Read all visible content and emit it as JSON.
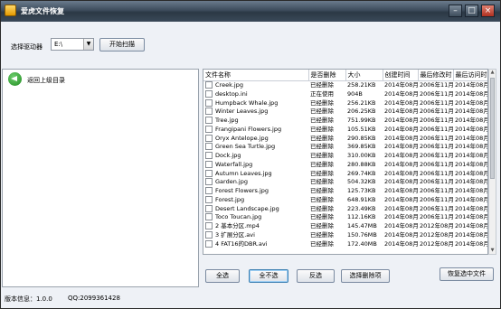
{
  "title": "爱虎文件恢复",
  "window_controls": {
    "minimize": "–",
    "maximize": "□",
    "close": "×"
  },
  "drive": {
    "label": "选择驱动器",
    "value": "E:\\",
    "scan_label": "开始扫描"
  },
  "left_pane": {
    "back_label": "返回上级目录"
  },
  "columns": [
    "文件名称",
    "是否删除",
    "大小",
    "创建时间",
    "最后修改时",
    "最后访问时"
  ],
  "rows": [
    {
      "name": "Creek.jpg",
      "status": "已经删除",
      "size": "258.21KB",
      "created": "2014年08月",
      "modified": "2006年11月",
      "accessed": "2014年08月"
    },
    {
      "name": "desktop.ini",
      "status": "正在使用",
      "size": "904B",
      "created": "2014年08月",
      "modified": "2006年11月",
      "accessed": "2014年08月"
    },
    {
      "name": "Humpback Whale.jpg",
      "status": "已经删除",
      "size": "256.21KB",
      "created": "2014年08月",
      "modified": "2006年11月",
      "accessed": "2014年08月"
    },
    {
      "name": "Winter Leaves.jpg",
      "status": "已经删除",
      "size": "206.25KB",
      "created": "2014年08月",
      "modified": "2006年11月",
      "accessed": "2014年08月"
    },
    {
      "name": "Tree.jpg",
      "status": "已经删除",
      "size": "751.99KB",
      "created": "2014年08月",
      "modified": "2006年11月",
      "accessed": "2014年08月"
    },
    {
      "name": "Frangipani Flowers.jpg",
      "status": "已经删除",
      "size": "105.51KB",
      "created": "2014年08月",
      "modified": "2006年11月",
      "accessed": "2014年08月"
    },
    {
      "name": "Oryx Antelope.jpg",
      "status": "已经删除",
      "size": "290.85KB",
      "created": "2014年08月",
      "modified": "2006年11月",
      "accessed": "2014年08月"
    },
    {
      "name": "Green Sea Turtle.jpg",
      "status": "已经删除",
      "size": "369.85KB",
      "created": "2014年08月",
      "modified": "2006年11月",
      "accessed": "2014年08月"
    },
    {
      "name": "Dock.jpg",
      "status": "已经删除",
      "size": "310.00KB",
      "created": "2014年08月",
      "modified": "2006年11月",
      "accessed": "2014年08月"
    },
    {
      "name": "Waterfall.jpg",
      "status": "已经删除",
      "size": "280.88KB",
      "created": "2014年08月",
      "modified": "2006年11月",
      "accessed": "2014年08月"
    },
    {
      "name": "Autumn Leaves.jpg",
      "status": "已经删除",
      "size": "269.74KB",
      "created": "2014年08月",
      "modified": "2006年11月",
      "accessed": "2014年08月"
    },
    {
      "name": "Garden.jpg",
      "status": "已经删除",
      "size": "504.32KB",
      "created": "2014年08月",
      "modified": "2006年11月",
      "accessed": "2014年08月"
    },
    {
      "name": "Forest Flowers.jpg",
      "status": "已经删除",
      "size": "125.73KB",
      "created": "2014年08月",
      "modified": "2006年11月",
      "accessed": "2014年08月"
    },
    {
      "name": "Forest.jpg",
      "status": "已经删除",
      "size": "648.91KB",
      "created": "2014年08月",
      "modified": "2006年11月",
      "accessed": "2014年08月"
    },
    {
      "name": "Desert Landscape.jpg",
      "status": "已经删除",
      "size": "223.49KB",
      "created": "2014年08月",
      "modified": "2006年11月",
      "accessed": "2014年08月"
    },
    {
      "name": "Toco Toucan.jpg",
      "status": "已经删除",
      "size": "112.16KB",
      "created": "2014年08月",
      "modified": "2006年11月",
      "accessed": "2014年08月"
    },
    {
      "name": "2 基本分区.mp4",
      "status": "已经删除",
      "size": "145.47MB",
      "created": "2014年08月",
      "modified": "2012年08月",
      "accessed": "2014年08月"
    },
    {
      "name": "3 扩展分区.avi",
      "status": "已经删除",
      "size": "150.76MB",
      "created": "2014年08月",
      "modified": "2012年08月",
      "accessed": "2014年08月"
    },
    {
      "name": "4 FAT16的DBR.avi",
      "status": "已经删除",
      "size": "172.40MB",
      "created": "2014年08月",
      "modified": "2012年08月",
      "accessed": "2014年08月"
    }
  ],
  "actions": {
    "select_all": "全选",
    "select_none": "全不选",
    "invert": "反选",
    "select_deleted": "选择删除项",
    "restore": "恢复选中文件"
  },
  "status": {
    "version": "版本信息：1.0.0",
    "qq": "QQ:2099361428"
  }
}
